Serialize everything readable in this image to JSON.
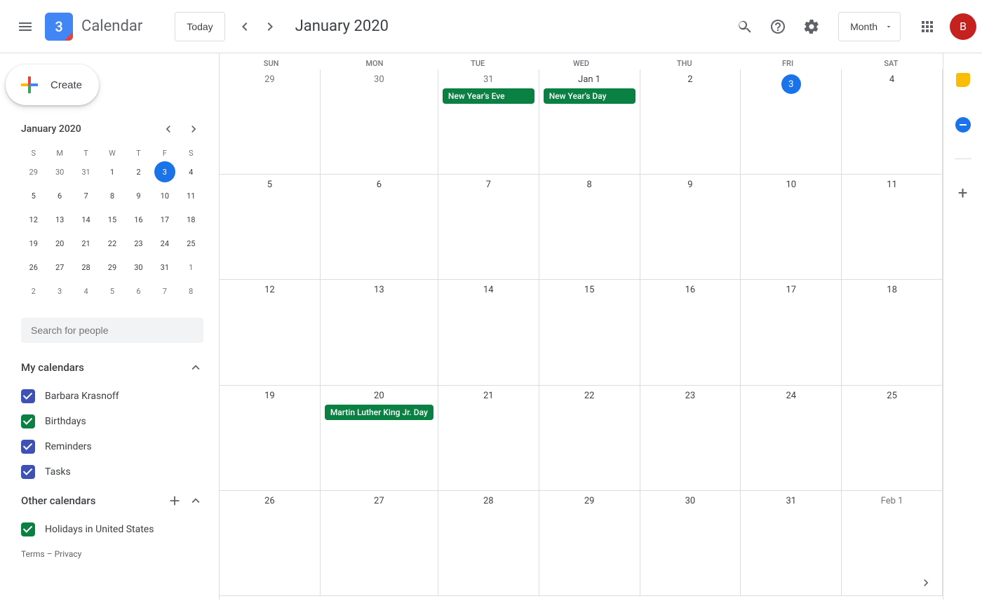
{
  "header": {
    "app_name": "Calendar",
    "logo_day": "3",
    "today_label": "Today",
    "title": "January 2020",
    "view": "Month",
    "avatar_initial": "B"
  },
  "minical": {
    "title": "January 2020",
    "day_headers": [
      "S",
      "M",
      "T",
      "W",
      "T",
      "F",
      "S"
    ],
    "weeks": [
      [
        {
          "d": "29",
          "o": true
        },
        {
          "d": "30",
          "o": true
        },
        {
          "d": "31",
          "o": true
        },
        {
          "d": "1"
        },
        {
          "d": "2"
        },
        {
          "d": "3",
          "t": true
        },
        {
          "d": "4"
        }
      ],
      [
        {
          "d": "5"
        },
        {
          "d": "6"
        },
        {
          "d": "7"
        },
        {
          "d": "8"
        },
        {
          "d": "9"
        },
        {
          "d": "10"
        },
        {
          "d": "11"
        }
      ],
      [
        {
          "d": "12"
        },
        {
          "d": "13"
        },
        {
          "d": "14"
        },
        {
          "d": "15"
        },
        {
          "d": "16"
        },
        {
          "d": "17"
        },
        {
          "d": "18"
        }
      ],
      [
        {
          "d": "19"
        },
        {
          "d": "20"
        },
        {
          "d": "21"
        },
        {
          "d": "22"
        },
        {
          "d": "23"
        },
        {
          "d": "24"
        },
        {
          "d": "25"
        }
      ],
      [
        {
          "d": "26"
        },
        {
          "d": "27"
        },
        {
          "d": "28"
        },
        {
          "d": "29"
        },
        {
          "d": "30"
        },
        {
          "d": "31"
        },
        {
          "d": "1",
          "o": true
        }
      ],
      [
        {
          "d": "2",
          "o": true
        },
        {
          "d": "3",
          "o": true
        },
        {
          "d": "4",
          "o": true
        },
        {
          "d": "5",
          "o": true
        },
        {
          "d": "6",
          "o": true
        },
        {
          "d": "7",
          "o": true
        },
        {
          "d": "8",
          "o": true
        }
      ]
    ]
  },
  "search_placeholder": "Search for people",
  "create_label": "Create",
  "my_calendars": {
    "title": "My calendars",
    "items": [
      {
        "label": "Barbara Krasnoff",
        "color": "blue"
      },
      {
        "label": "Birthdays",
        "color": "green"
      },
      {
        "label": "Reminders",
        "color": "blue"
      },
      {
        "label": "Tasks",
        "color": "blue"
      }
    ]
  },
  "other_calendars": {
    "title": "Other calendars",
    "items": [
      {
        "label": "Holidays in United States",
        "color": "green"
      }
    ]
  },
  "footer": {
    "terms": "Terms",
    "sep": " – ",
    "privacy": "Privacy"
  },
  "grid": {
    "day_headers": [
      "SUN",
      "MON",
      "TUE",
      "WED",
      "THU",
      "FRI",
      "SAT"
    ],
    "weeks": [
      [
        {
          "d": "29",
          "o": true
        },
        {
          "d": "30",
          "o": true
        },
        {
          "d": "31",
          "o": true,
          "events": [
            {
              "t": "New Year's Eve"
            }
          ]
        },
        {
          "d": "Jan 1",
          "events": [
            {
              "t": "New Year's Day"
            }
          ]
        },
        {
          "d": "2"
        },
        {
          "d": "3",
          "t": true
        },
        {
          "d": "4"
        }
      ],
      [
        {
          "d": "5"
        },
        {
          "d": "6"
        },
        {
          "d": "7"
        },
        {
          "d": "8"
        },
        {
          "d": "9"
        },
        {
          "d": "10"
        },
        {
          "d": "11"
        }
      ],
      [
        {
          "d": "12"
        },
        {
          "d": "13"
        },
        {
          "d": "14"
        },
        {
          "d": "15"
        },
        {
          "d": "16"
        },
        {
          "d": "17"
        },
        {
          "d": "18"
        }
      ],
      [
        {
          "d": "19"
        },
        {
          "d": "20",
          "events": [
            {
              "t": "Martin Luther King Jr. Day"
            }
          ]
        },
        {
          "d": "21"
        },
        {
          "d": "22"
        },
        {
          "d": "23"
        },
        {
          "d": "24"
        },
        {
          "d": "25"
        }
      ],
      [
        {
          "d": "26"
        },
        {
          "d": "27"
        },
        {
          "d": "28"
        },
        {
          "d": "29"
        },
        {
          "d": "30"
        },
        {
          "d": "31"
        },
        {
          "d": "Feb 1",
          "o": true
        }
      ]
    ]
  }
}
